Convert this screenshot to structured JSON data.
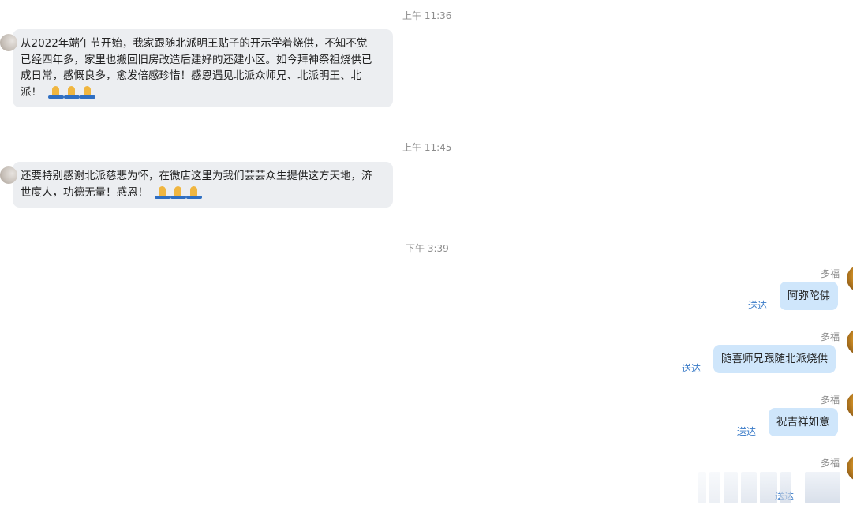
{
  "messages": {
    "t1": "上午 11:36",
    "m1_lines": [
      "从2022年端午节开始，我家跟随北派明王贴子的开示学着烧供，不知不觉",
      "已经四年多，家里也搬回旧房改造后建好的还建小区。如今拜神祭祖烧供已",
      "成日常，感慨良多，愈发倍感珍惜！感恩遇见北派众师兄、北派明王、北",
      "派！"
    ],
    "t2": "上午 11:45",
    "m2_lines": [
      "还要特别感谢北派慈悲为怀，在微店这里为我们芸芸众生提供这方天地，济",
      "世度人，功德无量！感恩！"
    ],
    "t3": "下午 3:39",
    "out": [
      {
        "sender": "多福",
        "text": "阿弥陀佛",
        "status": "送达"
      },
      {
        "sender": "多福",
        "text": "随喜师兄跟随北派烧供",
        "status": "送达"
      },
      {
        "sender": "多福",
        "text": "祝吉祥如意",
        "status": "送达"
      },
      {
        "sender": "多福",
        "text": "",
        "status": "送达"
      }
    ],
    "emoji": "pray-hands-icon x3"
  },
  "colors": {
    "incoming_bubble": "#eceef1",
    "outgoing_bubble": "#cfe6fb",
    "status_blue": "#3a7bc8",
    "timestamp_gray": "#8c8c8c"
  }
}
